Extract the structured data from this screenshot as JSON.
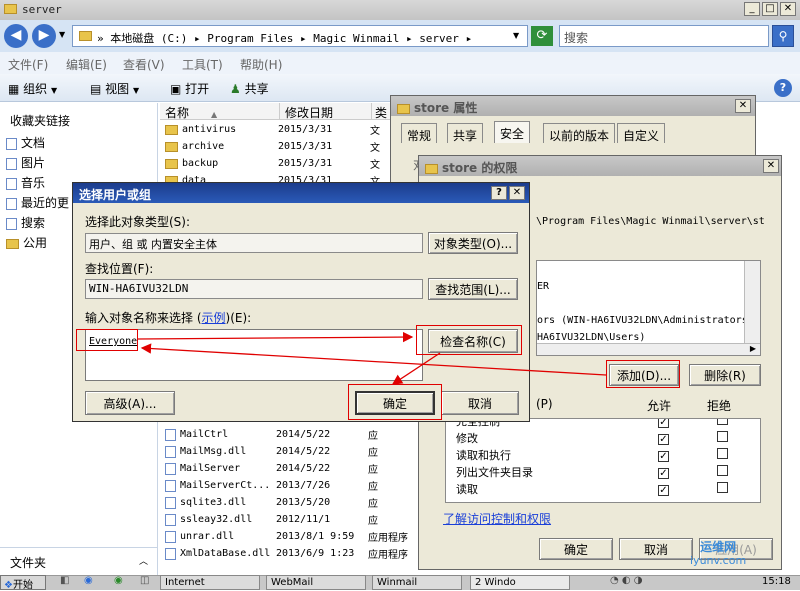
{
  "explorer": {
    "title": "server",
    "address": [
      "本地磁盘 (C:)",
      "Program Files",
      "Magic Winmail",
      "server"
    ],
    "search_placeholder": "搜索",
    "menu": [
      "文件(F)",
      "编辑(E)",
      "查看(V)",
      "工具(T)",
      "帮助(H)"
    ],
    "toolbar": {
      "organize": "组织",
      "view": "视图",
      "open": "打开",
      "share": "共享"
    },
    "nav_header": "收藏夹链接",
    "nav_items": [
      "文档",
      "图片",
      "音乐",
      "最近的更",
      "搜索",
      "公用"
    ],
    "nav_bottom": "文件夹",
    "columns": [
      "名称",
      "修改日期",
      "类"
    ],
    "files_top": [
      {
        "name": "antivirus",
        "date": "2015/3/31",
        "type": "文"
      },
      {
        "name": "archive",
        "date": "2015/3/31",
        "type": "文"
      },
      {
        "name": "backup",
        "date": "2015/3/31",
        "type": "文"
      },
      {
        "name": "data",
        "date": "2015/3/31",
        "type": "文"
      }
    ],
    "files_bottom": [
      {
        "name": "MailCtrl",
        "date": "2014/5/22",
        "type": "应"
      },
      {
        "name": "MailMsg.dll",
        "date": "2014/5/22",
        "type": "应"
      },
      {
        "name": "MailServer",
        "date": "2014/5/22",
        "type": "应"
      },
      {
        "name": "MailServerCt...",
        "date": "2013/7/26",
        "type": "应"
      },
      {
        "name": "sqlite3.dll",
        "date": "2013/5/20",
        "type": "应"
      },
      {
        "name": "ssleay32.dll",
        "date": "2012/11/1",
        "type": "应"
      },
      {
        "name": "unrar.dll",
        "date": "2013/8/1 9:59",
        "type": "应用程序"
      },
      {
        "name": "XmlDataBase.dll",
        "date": "2013/6/9 1:23",
        "type": "应用程序"
      }
    ]
  },
  "props": {
    "title": "store 属性",
    "tabs": [
      "常规",
      "共享",
      "安全",
      "以前的版本",
      "自定义"
    ],
    "fragment": "对"
  },
  "perms": {
    "title": "store 的权限",
    "path": "\\Program Files\\Magic Winmail\\server\\st",
    "users": [
      "ER",
      "ors (WIN-HA6IVU32LDN\\Administrators)",
      "HA6IVU32LDN\\Users)"
    ],
    "add": "添加(D)...",
    "remove": "删除(R)",
    "perm_header": "(P)",
    "allow": "允许",
    "deny": "拒绝",
    "perm_rows": [
      "完全控制",
      "修改",
      "读取和执行",
      "列出文件夹目录",
      "读取"
    ],
    "link": "了解访问控制和权限",
    "ok": "确定",
    "cancel": "取消",
    "apply": "应用(A)"
  },
  "select": {
    "title": "选择用户或组",
    "help": "?",
    "type_label": "选择此对象类型(S):",
    "type_value": "用户、组 或 内置安全主体",
    "type_btn": "对象类型(O)...",
    "loc_label": "查找位置(F):",
    "loc_value": "WIN-HA6IVU32LDN",
    "loc_btn": "查找范围(L)...",
    "name_label_pre": "输入对象名称来选择 (",
    "name_label_link": "示例",
    "name_label_post": ")(E):",
    "name_value": "Everyone",
    "check_btn": "检查名称(C)",
    "adv_btn": "高级(A)...",
    "ok_btn": "确定",
    "cancel_btn": "取消"
  },
  "taskbar": {
    "start": "开始",
    "items": [
      "Internet",
      "WebMail",
      "Winmail",
      "2 Windo"
    ],
    "clock": "15:18"
  },
  "watermark": {
    "name": "运维网",
    "url": "iyunv.com"
  }
}
